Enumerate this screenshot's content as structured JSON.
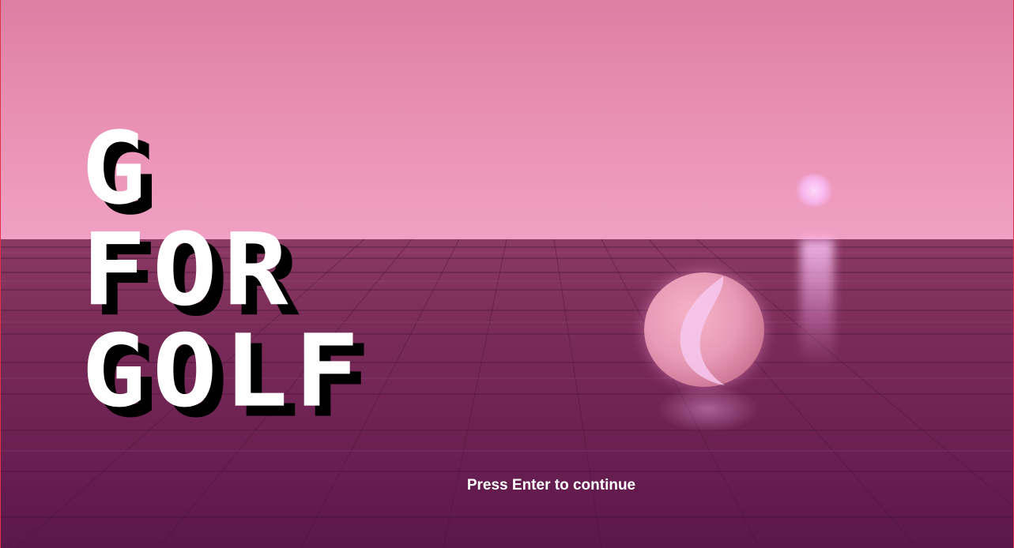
{
  "title": {
    "line1": "G",
    "line2": "FOR",
    "line3": "GOLF"
  },
  "prompt": "Press Enter to continue",
  "colors": {
    "sky_top": "#dd7ea3",
    "sky_bottom": "#f0a0c4",
    "floor": "#7a2c58",
    "title_text": "#ffffff",
    "title_shadow": "#000000",
    "ball": "#e89ab6"
  }
}
